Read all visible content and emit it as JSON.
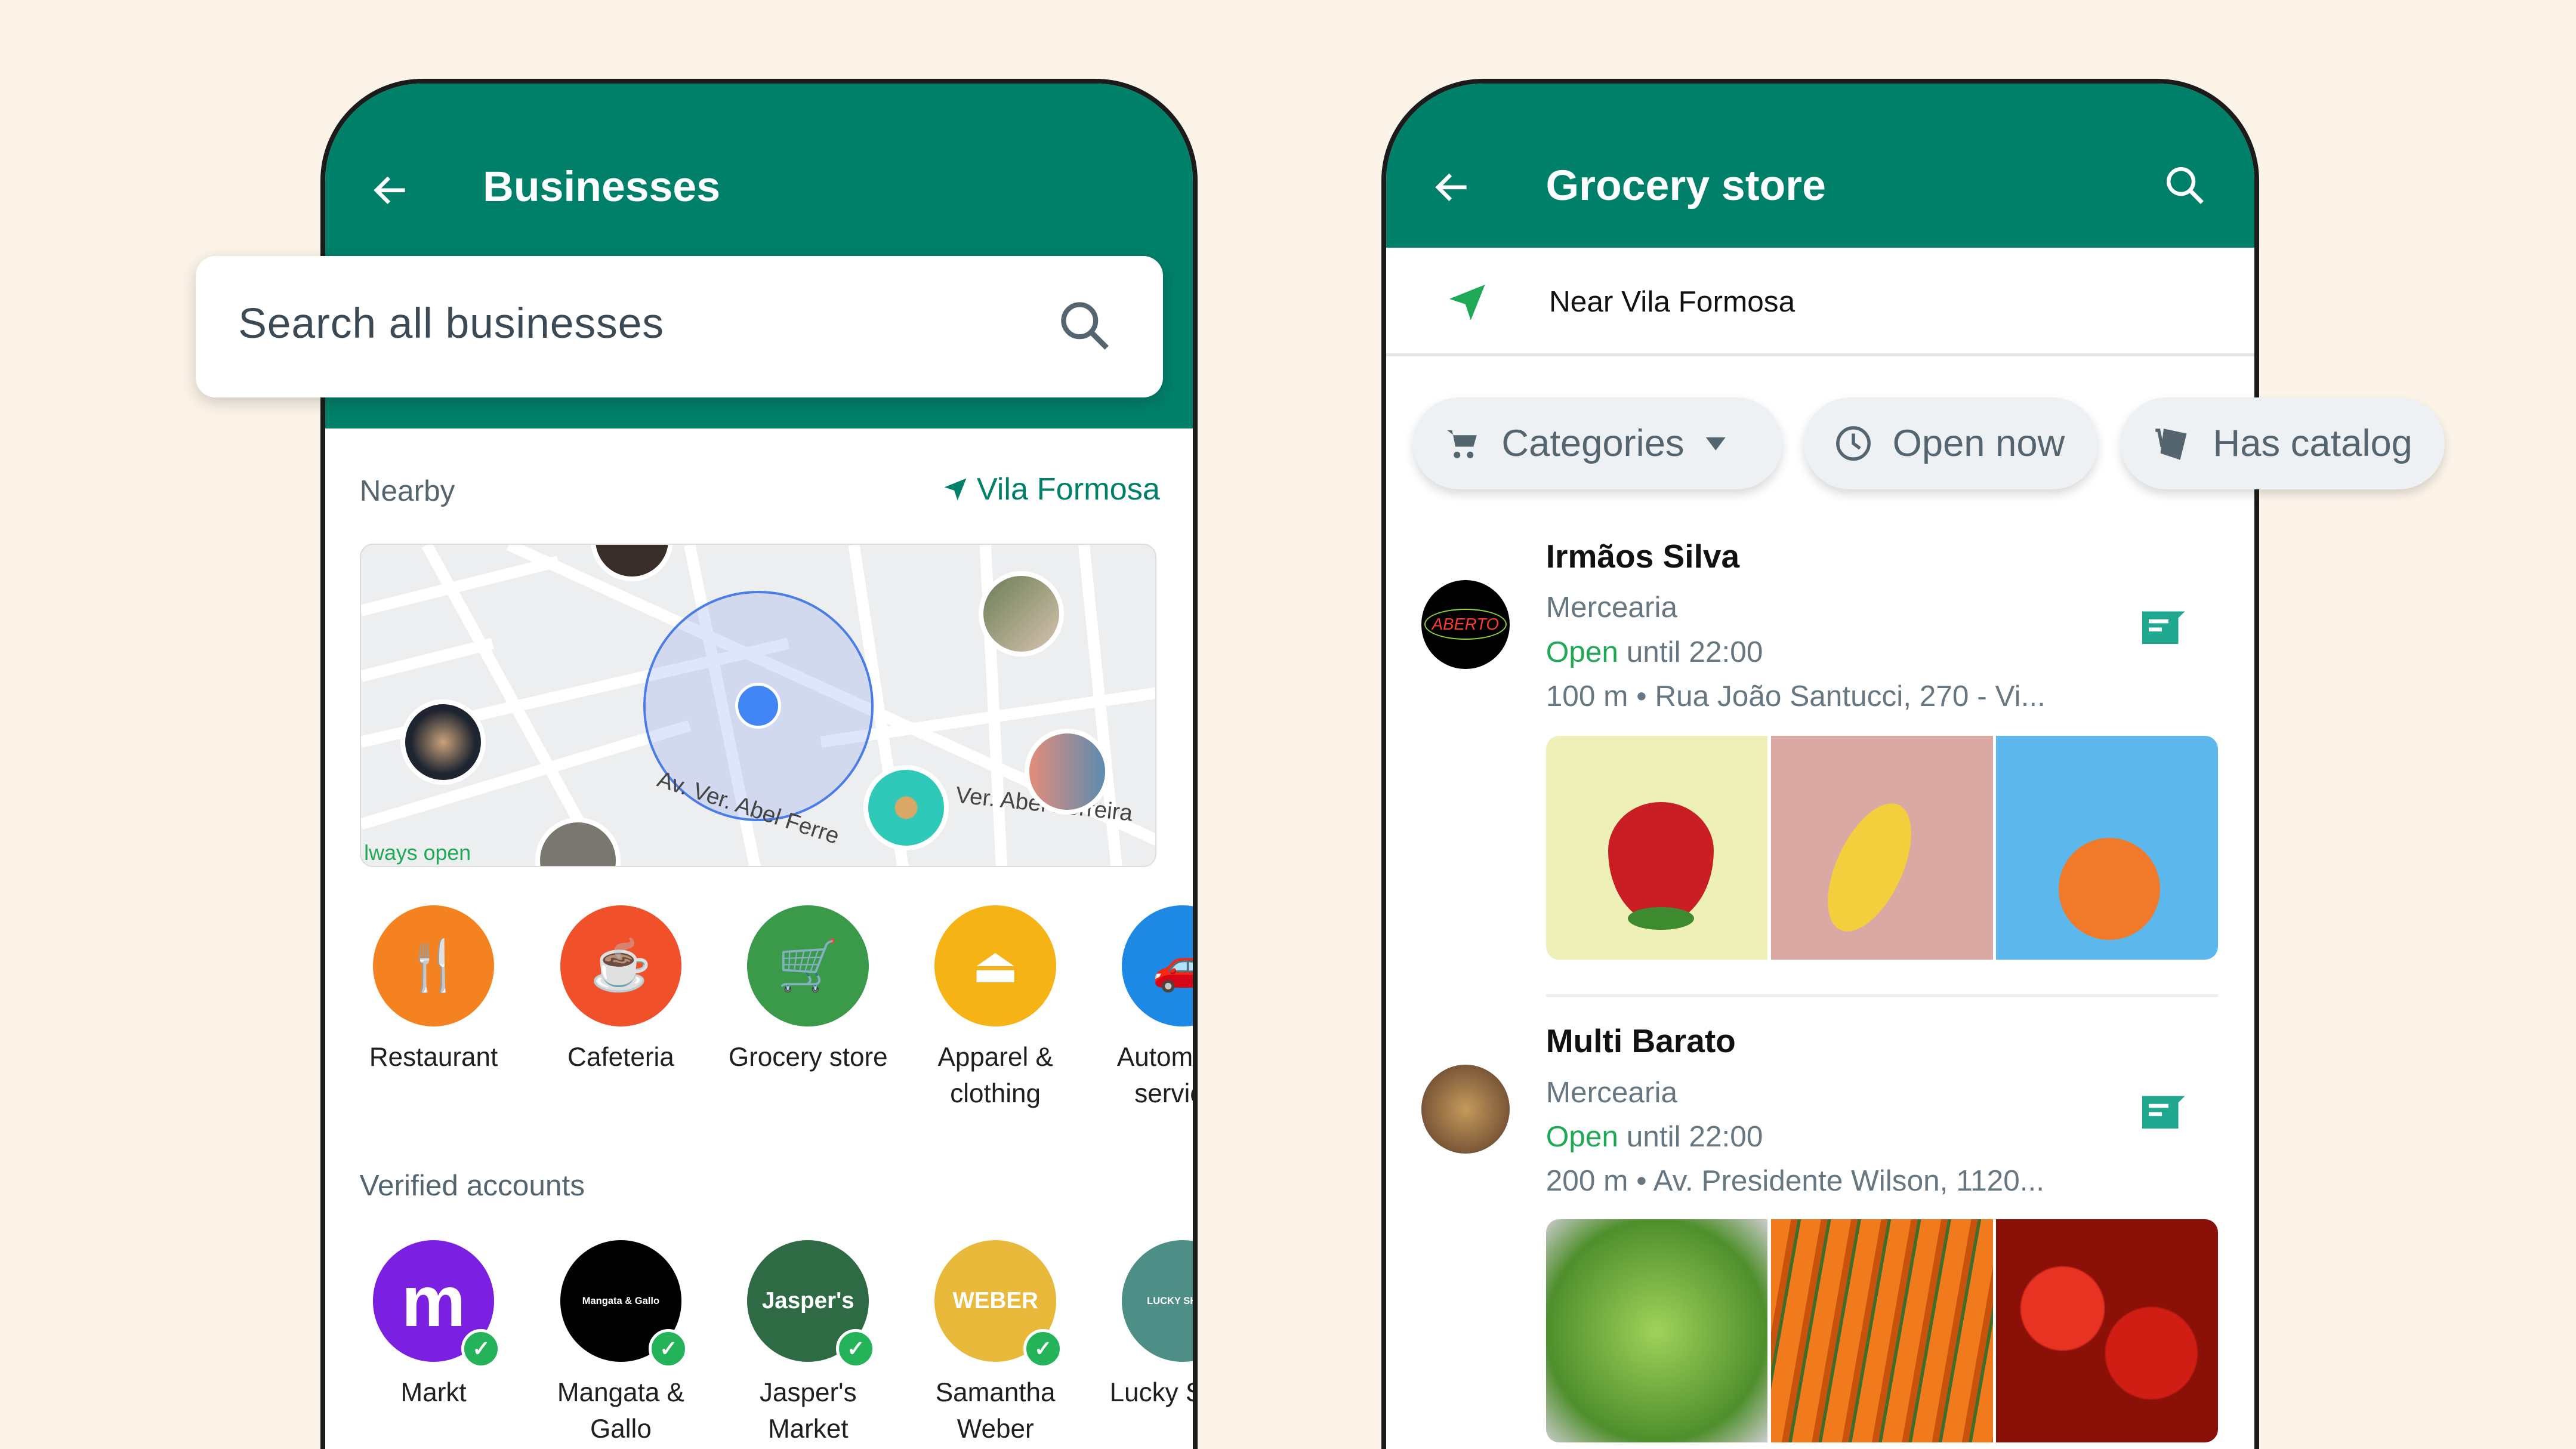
{
  "left_screen": {
    "title": "Businesses",
    "search_placeholder": "Search all businesses",
    "nearby_label": "Nearby",
    "location": "Vila Formosa",
    "map": {
      "street_1": "Av. Ver. Abel Ferre",
      "street_2": "Ver. Abel Ferreira",
      "partial_label": "lways open"
    },
    "categories": [
      {
        "label": "Restaurant",
        "icon": "restaurant-icon",
        "color": "#f58220"
      },
      {
        "label": "Cafeteria",
        "icon": "coffee-icon",
        "color": "#f0512b"
      },
      {
        "label": "Grocery store",
        "icon": "cart-icon",
        "color": "#3a9a4a"
      },
      {
        "label": "Apparel & clothing",
        "icon": "hanger-icon",
        "color": "#f5b316"
      },
      {
        "label": "Automotive services",
        "icon": "car-icon",
        "color": "#1e88e5"
      }
    ],
    "verified_label": "Verified accounts",
    "verified": [
      {
        "label": "Markt",
        "logo": "m",
        "color": "#7b1fe0"
      },
      {
        "label": "Mangata & Gallo",
        "logo": "Mangata & Gallo",
        "color": "#000000"
      },
      {
        "label": "Jasper's Market",
        "logo": "Jasper's",
        "color": "#2e6b45"
      },
      {
        "label": "Samantha Weber",
        "logo": "WEBER",
        "color": "#e8b93a"
      },
      {
        "label": "Lucky Shrub",
        "logo": "LUCKY SHRUB",
        "color": "#4d8f86"
      }
    ]
  },
  "right_screen": {
    "title": "Grocery store",
    "location": "Near Vila Formosa",
    "chips": {
      "categories": "Categories",
      "open_now": "Open now",
      "has_catalog": "Has catalog"
    },
    "results": [
      {
        "name": "Irmãos Silva",
        "type": "Mercearia",
        "open": "Open",
        "hours": "until 22:00",
        "address": "100 m • Rua João Santucci, 270 - Vi...",
        "logo": "ABERTO"
      },
      {
        "name": "Multi Barato",
        "type": "Mercearia",
        "open": "Open",
        "hours": "until 22:00",
        "address": "200 m • Av. Presidente Wilson, 1120..."
      }
    ]
  },
  "colors": {
    "brand": "#008069",
    "open": "#1fa855",
    "background": "#fcf4e8"
  }
}
